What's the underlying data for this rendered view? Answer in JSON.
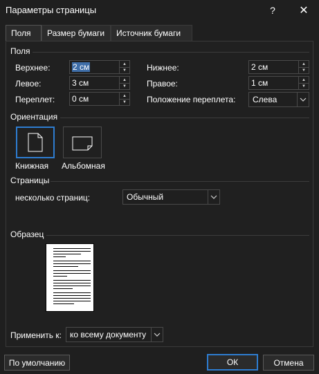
{
  "window": {
    "title": "Параметры страницы",
    "help_glyph": "?",
    "close_glyph": "✕"
  },
  "tabs": [
    {
      "label": "Поля",
      "active": true
    },
    {
      "label": "Размер бумаги",
      "active": false
    },
    {
      "label": "Источник бумаги",
      "active": false
    }
  ],
  "margins": {
    "section_title": "Поля",
    "top": {
      "label": "Верхнее:",
      "value": "2 см"
    },
    "bottom": {
      "label": "Нижнее:",
      "value": "2 см"
    },
    "left": {
      "label": "Левое:",
      "value": "3 см"
    },
    "right": {
      "label": "Правое:",
      "value": "1 см"
    },
    "gutter": {
      "label": "Переплет:",
      "value": "0 см"
    },
    "gutter_position": {
      "label": "Положение переплета:",
      "value": "Слева"
    }
  },
  "orientation": {
    "section_title": "Ориентация",
    "portrait_label": "Книжная",
    "landscape_label": "Альбомная",
    "selected": "portrait"
  },
  "pages": {
    "section_title": "Страницы",
    "multiple_label": "несколько страниц:",
    "multiple_value": "Обычный"
  },
  "preview": {
    "section_title": "Образец"
  },
  "apply": {
    "label": "Применить к:",
    "value": "ко всему документу"
  },
  "buttons": {
    "default_label": "По умолчанию",
    "ok_label": "ОК",
    "cancel_label": "Отмена"
  },
  "colors": {
    "background": "#1f1f1f",
    "accent": "#2e7dd1",
    "selection": "#3f6ea8"
  }
}
